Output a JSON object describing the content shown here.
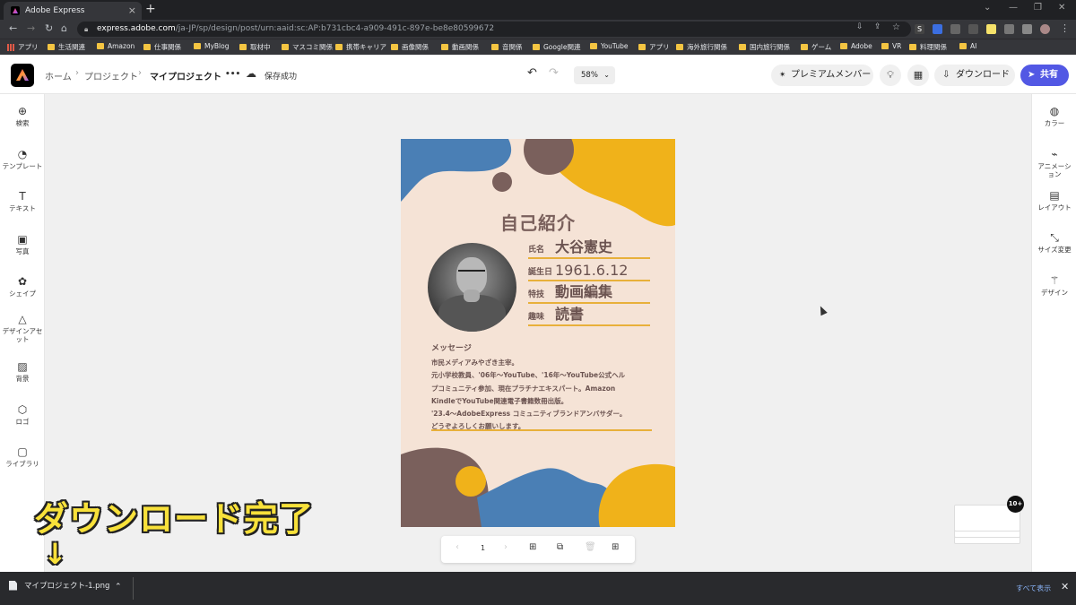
{
  "browser": {
    "tab_title": "Adobe Express",
    "new_tab": "+",
    "url_host": "express.adobe.com",
    "url_path": "/ja-JP/sp/design/post/urn:aaid:sc:AP:b731cbc4-a909-491c-897e-be8e80599672",
    "bookmarks": [
      "アプリ",
      "生活関連",
      "Amazon",
      "仕事関係",
      "MyBlog",
      "取材中",
      "マスコミ関係",
      "携帯キャリア",
      "画像関係",
      "動画関係",
      "音関係",
      "Google関連",
      "YouTube",
      "アプリ",
      "海外旅行関係",
      "国内旅行関係",
      "ゲーム",
      "Adobe",
      "VR",
      "料理関係",
      "AI"
    ]
  },
  "header": {
    "breadcrumb_home": "ホーム",
    "breadcrumb_projects": "プロジェクト",
    "breadcrumb_current": "マイプロジェクト",
    "more": "•••",
    "save_status": "保存成功",
    "zoom": "58%",
    "premium": "プレミアムメンバー",
    "download": "ダウンロード",
    "share": "共有"
  },
  "left_rail": [
    {
      "label": "検索",
      "icon": "search-icon"
    },
    {
      "label": "テンプレート",
      "icon": "template-icon"
    },
    {
      "label": "テキスト",
      "icon": "text-icon"
    },
    {
      "label": "写真",
      "icon": "photo-icon"
    },
    {
      "label": "シェイプ",
      "icon": "shape-icon"
    },
    {
      "label": "デザインアセット",
      "icon": "design-asset-icon"
    },
    {
      "label": "背景",
      "icon": "background-icon"
    },
    {
      "label": "ロゴ",
      "icon": "logo-icon"
    },
    {
      "label": "ライブラリ",
      "icon": "library-icon"
    }
  ],
  "right_rail": [
    {
      "label": "カラー",
      "icon": "palette-icon"
    },
    {
      "label": "アニメーション",
      "icon": "animation-icon"
    },
    {
      "label": "レイアウト",
      "icon": "layout-icon"
    },
    {
      "label": "サイズ変更",
      "icon": "resize-icon"
    },
    {
      "label": "デザイン",
      "icon": "magic-wand-icon"
    }
  ],
  "poster": {
    "title": "自己紹介",
    "fields": [
      {
        "key": "氏名",
        "value": "大谷憲史"
      },
      {
        "key": "誕生日",
        "value": "1961.6.12"
      },
      {
        "key": "特技",
        "value": "動画編集"
      },
      {
        "key": "趣味",
        "value": "読書"
      }
    ],
    "message_heading": "メッセージ",
    "message_lines": [
      "市民メディアみやざき主宰。",
      "元小学校教員、'06年〜YouTube、'16年〜YouTube公式ヘル",
      "プコミュニティ参加、現在プラチナエキスパート。Amazon",
      "KindleでYouTube関連電子書籍数冊出版。",
      "'23.4〜AdobeExpress コミュニティブランドアンバサダー。",
      "どうぞよろしくお願いします。"
    ],
    "colors": {
      "bg": "#f5e3d6",
      "blue": "#4a7fb5",
      "yellow": "#f0b21a",
      "brown": "#7a605c"
    }
  },
  "pager": {
    "page": "1"
  },
  "badge": "10+",
  "overlay": {
    "text": "ダウンロード完了",
    "arrow": "↓"
  },
  "download_bar": {
    "file": "マイプロジェクト-1.png",
    "show_all": "すべて表示"
  }
}
